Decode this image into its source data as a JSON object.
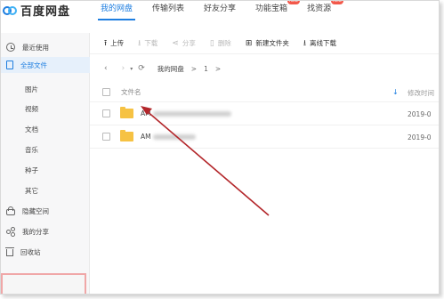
{
  "app": {
    "name": "百度网盘"
  },
  "nav": {
    "tabs": [
      {
        "label": "我的网盘",
        "active": true
      },
      {
        "label": "传输列表"
      },
      {
        "label": "好友分享"
      },
      {
        "label": "功能宝箱",
        "badge": "new"
      },
      {
        "label": "找资源",
        "badge": "new"
      }
    ]
  },
  "sidebar": {
    "items": [
      {
        "label": "最近使用",
        "icon": "clock-icon"
      },
      {
        "label": "全部文件",
        "icon": "document-icon",
        "active": true
      },
      {
        "label": "图片"
      },
      {
        "label": "视频"
      },
      {
        "label": "文档"
      },
      {
        "label": "音乐"
      },
      {
        "label": "种子"
      },
      {
        "label": "其它"
      },
      {
        "label": "隐藏空间",
        "icon": "lock-icon"
      },
      {
        "label": "我的分享",
        "icon": "share-icon"
      },
      {
        "label": "回收站",
        "icon": "trash-icon"
      }
    ]
  },
  "toolbar": {
    "upload": "上传",
    "download": "下载",
    "share": "分享",
    "delete": "删除",
    "new_folder": "新建文件夹",
    "offline_download": "离线下载"
  },
  "breadcrumb": {
    "root": "我的网盘",
    "sep": ">",
    "current": "1"
  },
  "list": {
    "col_name": "文件名",
    "col_date": "修改时间",
    "rows": [
      {
        "name": "AM",
        "date": "2019-0"
      },
      {
        "name": "AM",
        "date": "2019-0"
      }
    ]
  },
  "colors": {
    "accent": "#1e7ee0",
    "folder": "#f6c243",
    "annotation": "#b3262a"
  }
}
